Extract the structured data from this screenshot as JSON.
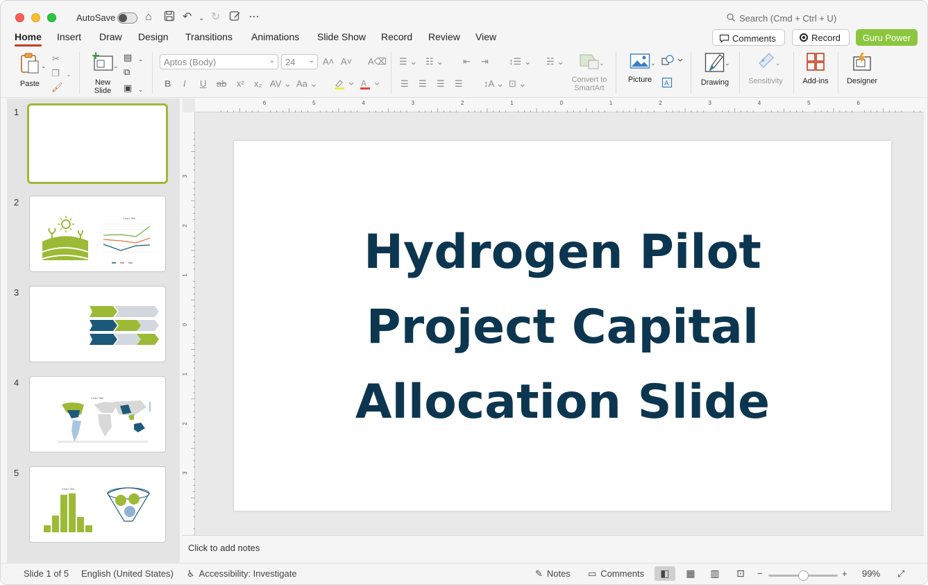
{
  "titlebar": {
    "autosave_label": "AutoSave",
    "search_placeholder": "Search (Cmd + Ctrl + U)"
  },
  "tabs": [
    "Home",
    "Insert",
    "Draw",
    "Design",
    "Transitions",
    "Animations",
    "Slide Show",
    "Record",
    "Review",
    "View"
  ],
  "header_buttons": {
    "comments": "Comments",
    "record": "Record",
    "guru": "Guru Power"
  },
  "ribbon": {
    "paste": "Paste",
    "new_slide": "New Slide",
    "font_name": "Aptos (Body)",
    "font_size": "24",
    "convert_smartart": "Convert to SmartArt",
    "picture": "Picture",
    "drawing": "Drawing",
    "sensitivity": "Sensitivity",
    "addins": "Add-ins",
    "designer": "Designer"
  },
  "thumbnails": [
    {
      "num": "1",
      "selected": true
    },
    {
      "num": "2",
      "chart_title": "Chart Title"
    },
    {
      "num": "3"
    },
    {
      "num": "4",
      "chart_title": "Chart Title"
    },
    {
      "num": "5",
      "chart_title": "Chart Title"
    }
  ],
  "slide": {
    "title_line1": "Hydrogen Pilot",
    "title_line2": "Project Capital",
    "title_line3": "Allocation Slide",
    "title_color": "#0c3650"
  },
  "ruler": {
    "h_labels": [
      "6",
      "5",
      "4",
      "3",
      "2",
      "1",
      "0",
      "1",
      "2",
      "3",
      "4",
      "5",
      "6"
    ],
    "v_labels": [
      "3",
      "2",
      "1",
      "0",
      "1",
      "2",
      "3"
    ]
  },
  "notes_placeholder": "Click to add notes",
  "statusbar": {
    "slide_count": "Slide 1 of 5",
    "language": "English (United States)",
    "accessibility": "Accessibility: Investigate",
    "notes": "Notes",
    "comments": "Comments",
    "zoom": "99%",
    "zoom_fraction": 0.5
  },
  "colors": {
    "accent": "#c43e1c",
    "guru": "#8cc63f",
    "green": "#a3b53a",
    "navy": "#1d5a7a",
    "light": "#d3d8de"
  },
  "icons": [
    "home-icon",
    "save-icon",
    "undo-icon",
    "redo-icon",
    "more-icon",
    "search-icon",
    "comment-icon",
    "record-icon"
  ]
}
